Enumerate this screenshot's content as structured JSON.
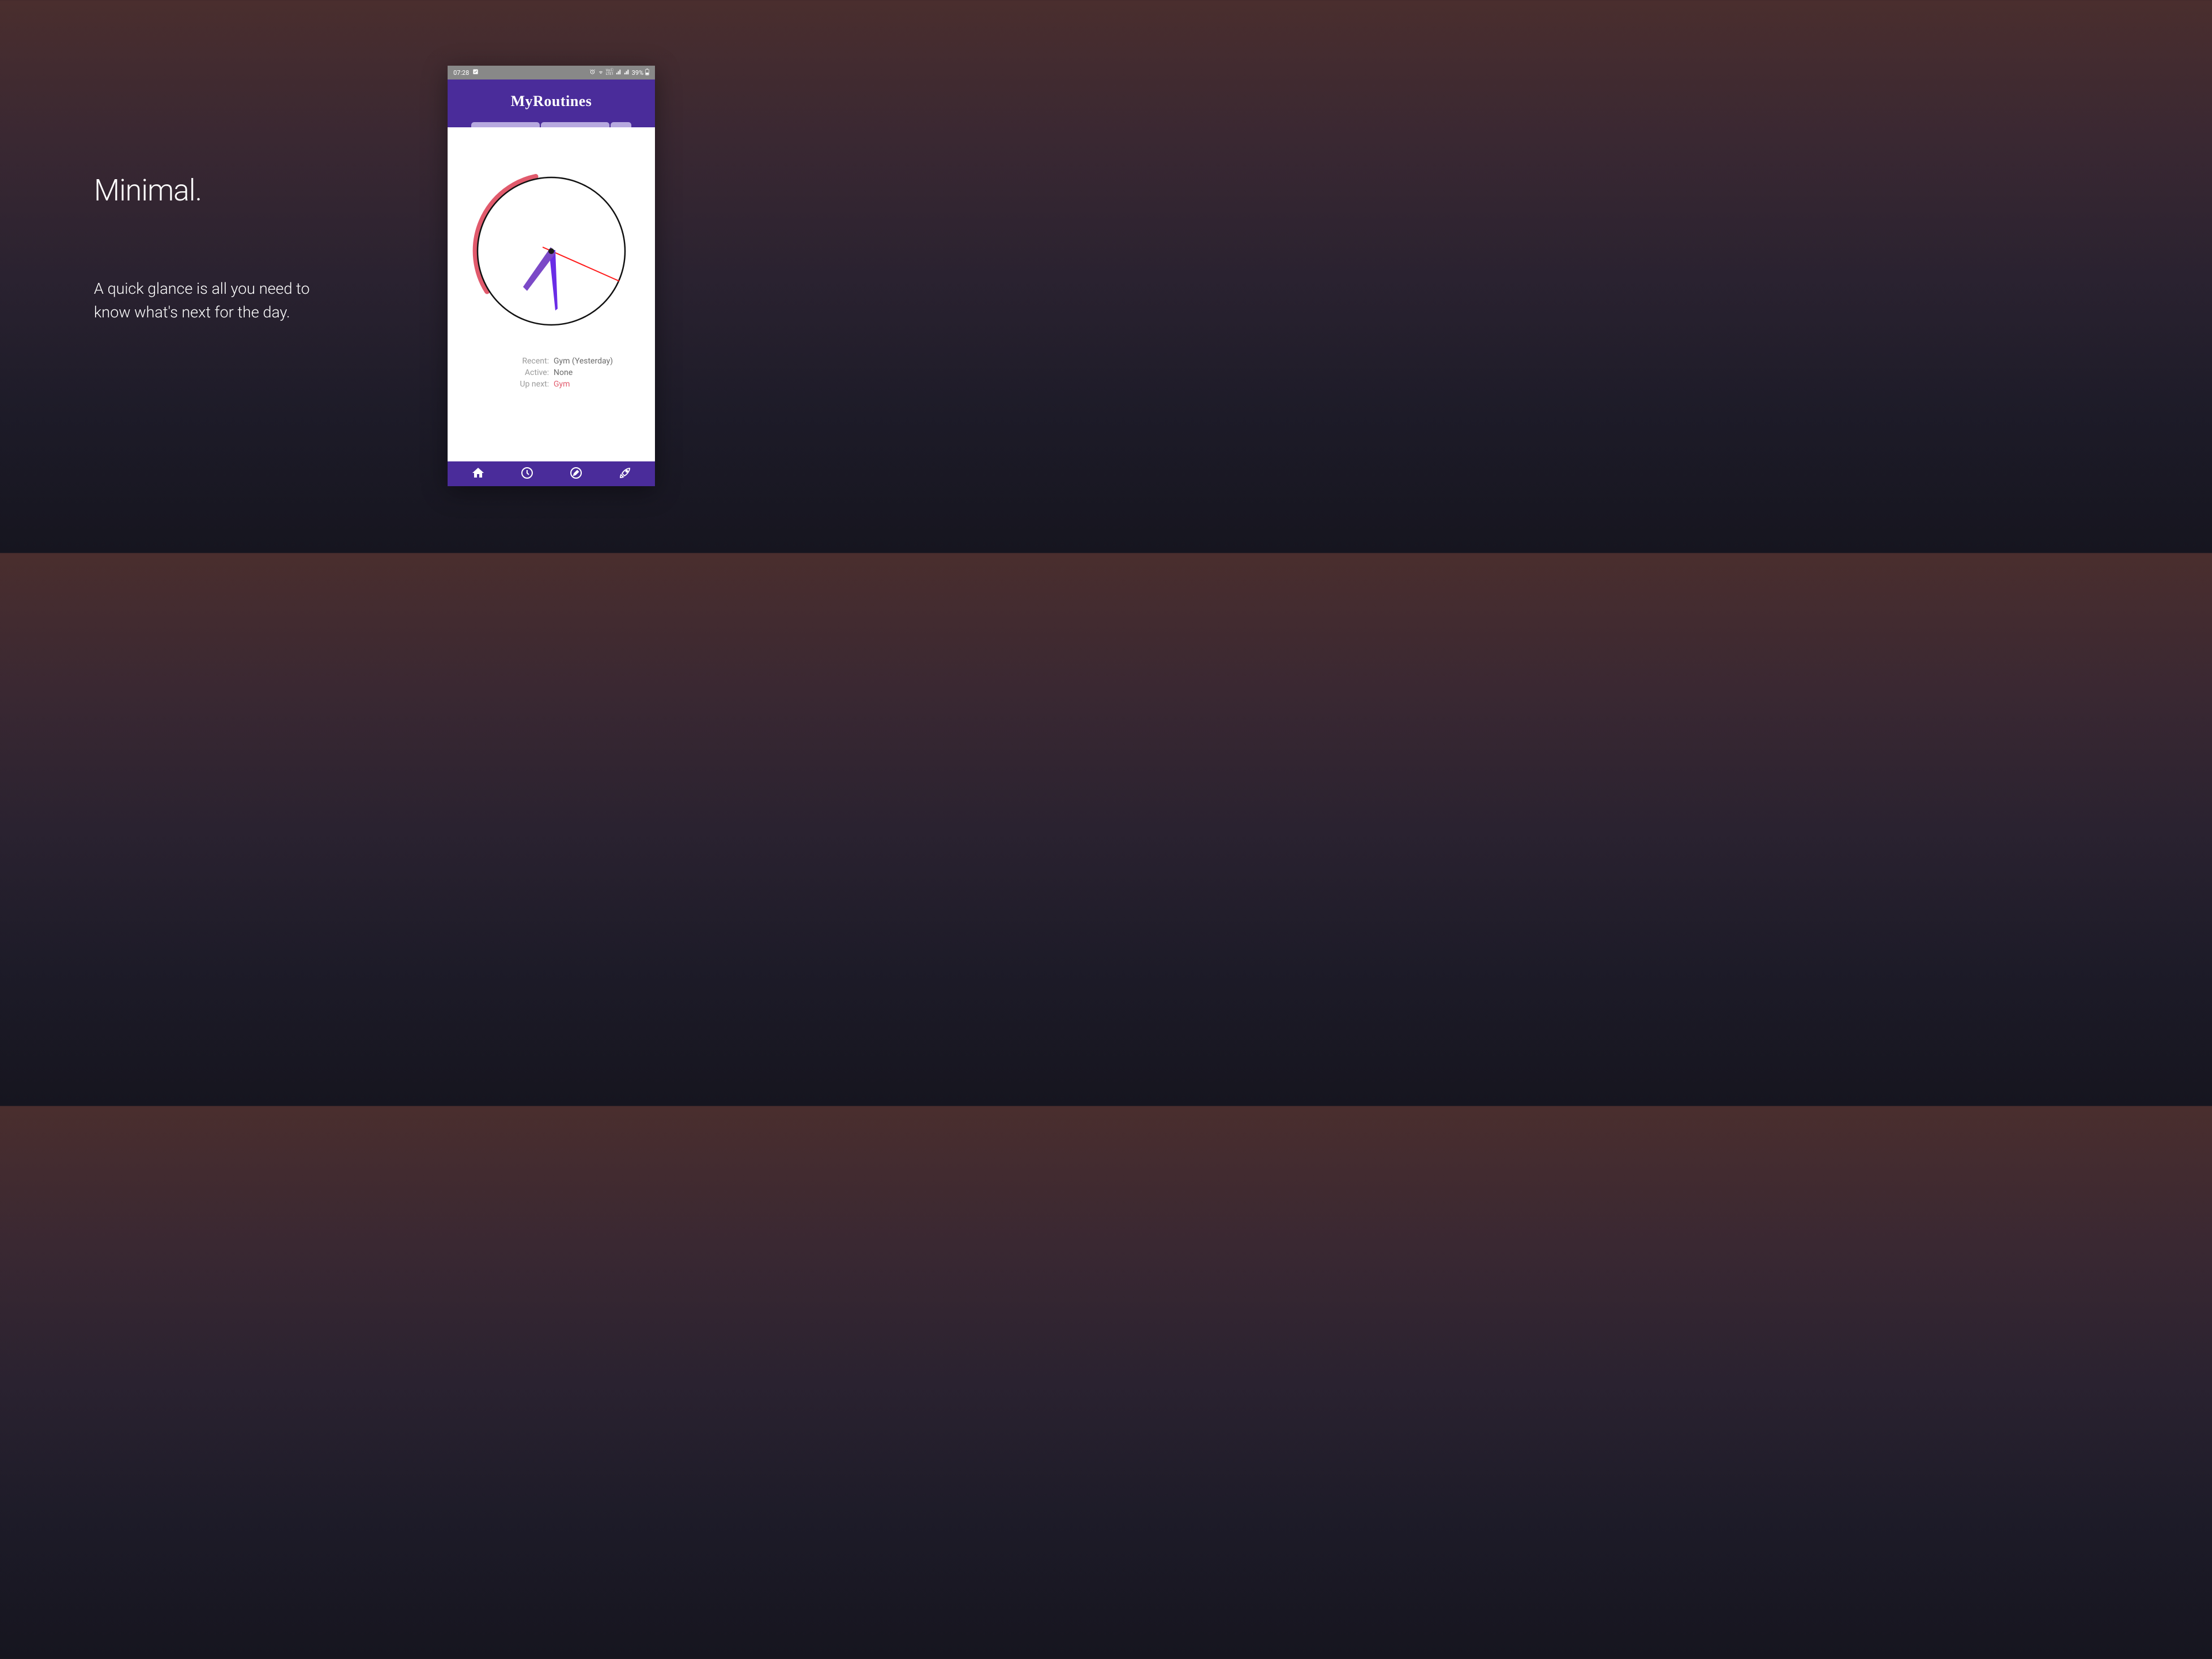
{
  "promo": {
    "title": "Minimal.",
    "desc": "A quick glance is all you need to know what's next for the day."
  },
  "status_bar": {
    "time": "07:28",
    "battery": "39%"
  },
  "app": {
    "title": "MyRoutines"
  },
  "info": {
    "recent_label": "Recent:",
    "recent_value": "Gym (Yesterday)",
    "active_label": "Active:",
    "active_value": "None",
    "upnext_label": "Up next:",
    "upnext_value": "Gym"
  },
  "clock": {
    "hour_hand_angle": 225,
    "minute_hand_angle": 170,
    "second_hand_angle": 115,
    "arc_start": 320,
    "arc_end": 235,
    "arc_color": "#e15a6c"
  }
}
